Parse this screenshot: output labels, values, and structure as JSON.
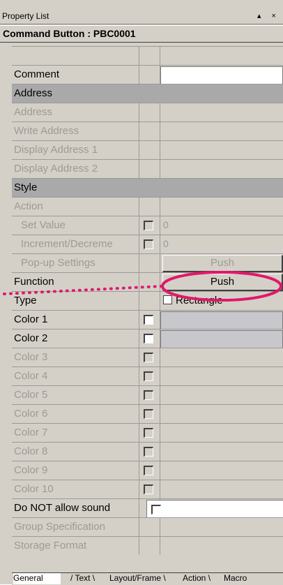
{
  "panel_title": "Property List",
  "title_controls": "▴ ×",
  "object_line": "Command Button : PBC0001",
  "rows": [
    {
      "label": "",
      "kind": "header"
    },
    {
      "label": "Comment",
      "kind": "enabled",
      "field": "white"
    },
    {
      "label": "Address",
      "kind": "category"
    },
    {
      "label": "Address",
      "kind": "disabled"
    },
    {
      "label": "Write Address",
      "kind": "disabled"
    },
    {
      "label": "Display Address 1",
      "kind": "disabled"
    },
    {
      "label": "Display Address 2",
      "kind": "disabled"
    },
    {
      "label": "Style",
      "kind": "category"
    },
    {
      "label": "Action",
      "kind": "disabled"
    },
    {
      "label": "Set Value",
      "kind": "disabled",
      "indent": true,
      "check": true,
      "value": "0"
    },
    {
      "label": "Increment/Decreme",
      "kind": "disabled",
      "indent": true,
      "check": true,
      "value": "0"
    },
    {
      "label": "Pop-up Settings",
      "kind": "disabled",
      "indent": true,
      "button": "Push"
    },
    {
      "label": "Function",
      "kind": "enabled",
      "button": "Push"
    },
    {
      "label": "Type",
      "kind": "enabled",
      "option": "Rectangle"
    },
    {
      "label": "Color 1",
      "kind": "enabled",
      "check": true,
      "field": "gray"
    },
    {
      "label": "Color 2",
      "kind": "enabled",
      "check": true,
      "field": "gray"
    },
    {
      "label": "Color 3",
      "kind": "disabled",
      "check": true
    },
    {
      "label": "Color 4",
      "kind": "disabled",
      "check": true
    },
    {
      "label": "Color 5",
      "kind": "disabled",
      "check": true
    },
    {
      "label": "Color 6",
      "kind": "disabled",
      "check": true
    },
    {
      "label": "Color 7",
      "kind": "disabled",
      "check": true
    },
    {
      "label": "Color 8",
      "kind": "disabled",
      "check": true
    },
    {
      "label": "Color 9",
      "kind": "disabled",
      "check": true
    },
    {
      "label": "Color 10",
      "kind": "disabled",
      "check": true
    },
    {
      "label": "Do NOT allow sound",
      "kind": "enabled",
      "sound_check": true
    },
    {
      "label": "Group Specification",
      "kind": "disabled"
    },
    {
      "label": "Storage Format",
      "kind": "disabled"
    }
  ],
  "tabs": [
    "General",
    "Text",
    "Layout/Frame",
    "Action",
    "Macro"
  ],
  "active_tab": "General",
  "colors": {
    "panel": "#d4d0c8",
    "category": "#a9a9a9",
    "highlight": "#e0196a",
    "disabled_text": "#9c9a94"
  }
}
